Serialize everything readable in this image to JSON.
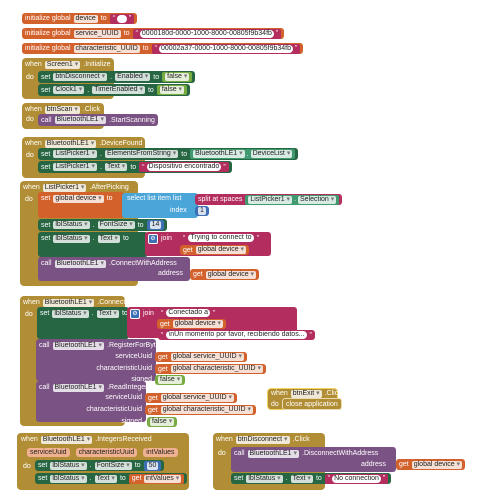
{
  "kw": {
    "initialize_global": "initialize global",
    "to": "to",
    "when": "when",
    "do": "do",
    "set": "set",
    "call": "call",
    "get": "get",
    "dot": "."
  },
  "globals": [
    {
      "name": "device",
      "value": ""
    },
    {
      "name": "service_UUID",
      "value": "0000180d-0000-1000-8000-00805f9b34fb"
    },
    {
      "name": "characteristic_UUID",
      "value": "00002a37-0000-1000-8000-00805f9b34fb"
    }
  ],
  "screen_init": {
    "component": "Screen1",
    "event": ".Initialize",
    "s1": {
      "comp": "btnDisconnect",
      "prop": "Enabled",
      "value": "false"
    },
    "s2": {
      "comp": "Clock1",
      "prop": "TimerEnabled",
      "value": "false"
    }
  },
  "btn_scan": {
    "component": "btnScan",
    "event": ".Click",
    "call_comp": "BluetoothLE1",
    "method": ".StartScanning"
  },
  "device_found": {
    "component": "BluetoothLE1",
    "event": ".DeviceFound",
    "s1": {
      "comp": "ListPicker1",
      "prop": "ElementsFromString",
      "src_comp": "BluetoothLE1",
      "src_prop": "DeviceList"
    },
    "s2": {
      "comp": "ListPicker1",
      "prop": "Text",
      "value": "Dispositivo encontrado"
    }
  },
  "after_picking": {
    "component": "ListPicker1",
    "event": ".AfterPicking",
    "var": "global device",
    "select": "select list item  list",
    "index_label": "index",
    "index": "1",
    "split": "split at spaces",
    "sel_comp": "ListPicker1",
    "sel_prop": "Selection",
    "font_comp": "lblStatus",
    "font_prop": "FontSize",
    "font_value": "14",
    "text_comp": "lblStatus",
    "text_prop": "Text",
    "join": "join",
    "join_str": "Trying to connect to ",
    "join_get": "global device",
    "call_comp": "BluetoothLE1",
    "method": ".ConnectWithAddress",
    "address_label": "address",
    "address_get": "global device"
  },
  "connected": {
    "component": "BluetoothLE1",
    "event": ".Connected",
    "text_comp": "lblStatus",
    "text_prop": "Text",
    "join": "join",
    "str1": "Conectado a ",
    "get1": "global device",
    "str2": "\\nUn momento por favor, recibiendo datos...",
    "reg": {
      "comp": "BluetoothLE1",
      "method": ".RegisterForBytes",
      "service_label": "serviceUuid",
      "service_get": "global service_UUID",
      "char_label": "characteristicUuid",
      "char_get": "global characteristic_UUID",
      "signed_label": "signed",
      "signed": "false"
    },
    "read": {
      "comp": "BluetoothLE1",
      "method": ".ReadIntegers",
      "service_label": "serviceUuid",
      "service_get": "global service_UUID",
      "char_label": "characteristicUuid",
      "char_get": "global characteristic_UUID",
      "signed_label": "signed",
      "signed": "false"
    }
  },
  "btn_exit": {
    "component": "btnExit",
    "event": ".Click",
    "action": "close application"
  },
  "integers_received": {
    "component": "BluetoothLE1",
    "event": ".IntegersReceived",
    "params": [
      "serviceUuid",
      "characteristicUuid",
      "intValues"
    ],
    "font_comp": "lblStatus",
    "font_prop": "FontSize",
    "font_value": "50",
    "text_comp": "lblStatus",
    "text_prop": "Text",
    "text_get": "intValues"
  },
  "btn_disconnect": {
    "component": "btnDisconnect",
    "event": ".Click",
    "call_comp": "BluetoothLE1",
    "method": ".DisconnectWithAddress",
    "address_label": "address",
    "address_get": "global device",
    "text_comp": "lblStatus",
    "text_prop": "Text",
    "text_value": "No connection"
  },
  "colors": {
    "event": "#b18e35",
    "variable": "#d2612c",
    "text": "#b32d5e",
    "setter": "#266642",
    "logic": "#77ab41",
    "procedure": "#7a5283",
    "list": "#4aa6d8",
    "math": "#3e6fb5",
    "component": "#3f9a6f"
  }
}
